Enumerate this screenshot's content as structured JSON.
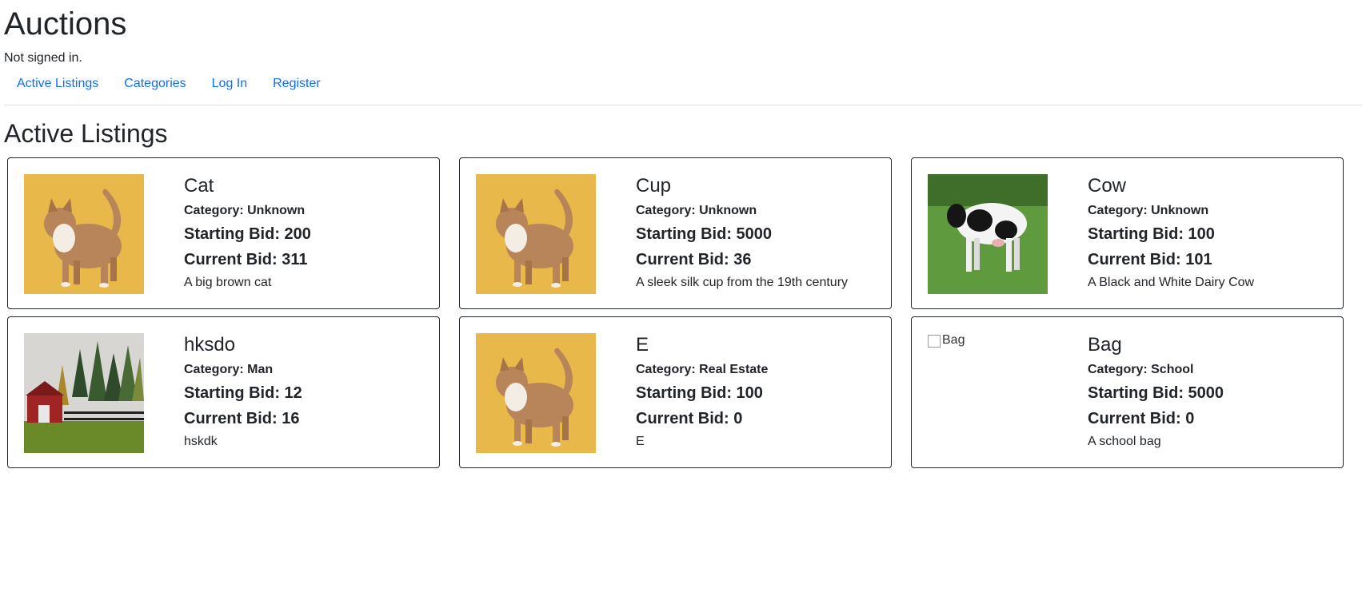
{
  "header": {
    "title": "Auctions",
    "status": "Not signed in."
  },
  "nav": {
    "items": [
      "Active Listings",
      "Categories",
      "Log In",
      "Register"
    ]
  },
  "main": {
    "title": "Active Listings",
    "listings": [
      {
        "name": "Cat",
        "category": "Category: Unknown",
        "starting_bid": "Starting Bid: 200",
        "current_bid": "Current Bid: 311",
        "description": "A big brown cat",
        "image": "cat-photo"
      },
      {
        "name": "Cup",
        "category": "Category: Unknown",
        "starting_bid": "Starting Bid: 5000",
        "current_bid": "Current Bid: 36",
        "description": "A sleek silk cup from the 19th century",
        "image": "cat-photo"
      },
      {
        "name": "Cow",
        "category": "Category: Unknown",
        "starting_bid": "Starting Bid: 100",
        "current_bid": "Current Bid: 101",
        "description": "A Black and White Dairy Cow",
        "image": "cow-photo"
      },
      {
        "name": "hksdo",
        "category": "Category: Man",
        "starting_bid": "Starting Bid: 12",
        "current_bid": "Current Bid: 16",
        "description": "hskdk",
        "image": "barn-photo"
      },
      {
        "name": "E",
        "category": "Category: Real Estate",
        "starting_bid": "Starting Bid: 100",
        "current_bid": "Current Bid: 0",
        "description": "E",
        "image": "cat-photo"
      },
      {
        "name": "Bag",
        "category": "Category: School",
        "starting_bid": "Starting Bid: 5000",
        "current_bid": "Current Bid: 0",
        "description": "A school bag",
        "image": "broken",
        "image_alt": "Bag"
      }
    ]
  },
  "colors": {
    "link": "#0d6efd",
    "text": "#212529",
    "cat_background": "#e8b84a"
  }
}
